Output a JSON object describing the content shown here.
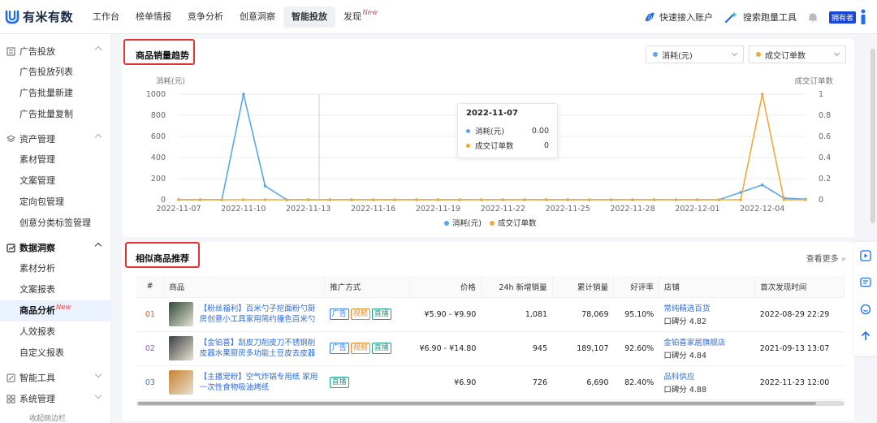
{
  "brand": {
    "name": "有米有数",
    "accent": "#1e6cf0"
  },
  "nav": {
    "items": [
      {
        "label": "工作台"
      },
      {
        "label": "榜单情报"
      },
      {
        "label": "竞争分析"
      },
      {
        "label": "创意洞察"
      },
      {
        "label": "智能投放",
        "active": true
      },
      {
        "label": "发现",
        "badge": "New"
      }
    ],
    "quick_link": "快速接入账户",
    "search_tool": "搜索跑量工具",
    "owner_badge": "拥有者"
  },
  "sidebar": {
    "sections": [
      {
        "label": "广告投放",
        "icon": "ad-icon",
        "items": [
          "广告投放列表",
          "广告批量新建",
          "广告批量复制"
        ]
      },
      {
        "label": "资产管理",
        "icon": "layers-icon",
        "items": [
          "素材管理",
          "文案管理",
          "定向包管理",
          "创意分类标签管理"
        ]
      },
      {
        "label": "数据洞察",
        "icon": "insight-icon",
        "items": [
          "素材分析",
          "文案报表",
          "商品分析",
          "人效报表",
          "自定义报表"
        ],
        "active_item": "商品分析",
        "active_badge": "New"
      },
      {
        "label": "智能工具",
        "icon": "tool-icon"
      },
      {
        "label": "系统管理",
        "icon": "grid-icon"
      }
    ],
    "collapse_label": "收起侧边栏"
  },
  "trend": {
    "title": "商品销量趋势",
    "dropdown_left": "消耗(元)",
    "dropdown_right": "成交订单数",
    "tooltip": {
      "date": "2022-11-07",
      "rows": [
        {
          "label": "消耗(元)",
          "value": "0.00"
        },
        {
          "label": "成交订单数",
          "value": "0"
        }
      ]
    }
  },
  "chart_data": {
    "type": "line",
    "ylabel": "消耗(元)",
    "ylabel_right": "成交订单数",
    "ylim": [
      0,
      1000
    ],
    "ylim_right": [
      0,
      1
    ],
    "yticks": [
      "0",
      "200",
      "400",
      "600",
      "800",
      "1000"
    ],
    "yticks_right": [
      "0",
      "0.2",
      "0.4",
      "0.6",
      "0.8",
      "1"
    ],
    "xticks": [
      "2022-11-07",
      "2022-11-10",
      "2022-11-13",
      "2022-11-16",
      "2022-11-19",
      "2022-11-22",
      "2022-11-25",
      "2022-11-28",
      "2022-12-01",
      "2022-12-04"
    ],
    "x": [
      "2022-11-07",
      "2022-11-08",
      "2022-11-09",
      "2022-11-10",
      "2022-11-11",
      "2022-11-12",
      "2022-11-13",
      "2022-11-14",
      "2022-11-15",
      "2022-11-16",
      "2022-11-17",
      "2022-11-18",
      "2022-11-19",
      "2022-11-20",
      "2022-11-21",
      "2022-11-22",
      "2022-11-23",
      "2022-11-24",
      "2022-11-25",
      "2022-11-26",
      "2022-11-27",
      "2022-11-28",
      "2022-11-29",
      "2022-11-30",
      "2022-12-01",
      "2022-12-02",
      "2022-12-03",
      "2022-12-04",
      "2022-12-05",
      "2022-12-06"
    ],
    "series": [
      {
        "name": "消耗(元)",
        "color": "#5aa6e8",
        "axis": "left",
        "values": [
          0,
          0,
          0,
          1000,
          130,
          0,
          0,
          0,
          0,
          0,
          0,
          0,
          0,
          0,
          0,
          0,
          0,
          0,
          0,
          0,
          0,
          0,
          0,
          0,
          0,
          0,
          70,
          140,
          15,
          5
        ]
      },
      {
        "name": "成交订单数",
        "color": "#f0a93a",
        "axis": "right",
        "values": [
          0,
          0,
          0,
          0,
          0,
          0,
          0,
          0,
          0,
          0,
          0,
          0,
          0,
          0,
          0,
          0,
          0,
          0,
          0,
          0,
          0,
          0,
          0,
          0,
          0,
          0,
          0,
          1,
          0,
          0
        ]
      }
    ],
    "grid": true,
    "legend": "bottom-center"
  },
  "similar": {
    "title": "相似商品推荐",
    "more": "查看更多",
    "columns": [
      "#",
      "商品",
      "推广方式",
      "价格",
      "24h 新增销量",
      "累计销量",
      "好评率",
      "店铺",
      "首次发现时间"
    ],
    "rows": [
      {
        "idx": "01",
        "idx_color": "#e0572e",
        "name": "【粉丝福利】百米勺子挖面粉勺厨房创意小工具家用简约撞色百米勺",
        "tags": [
          "广告",
          "视频",
          "直播"
        ],
        "price": "¥5.90 - ¥9.90",
        "new24": "1,081",
        "total": "78,069",
        "rate": "95.10%",
        "shop": "常纯精选百货",
        "score": "口碑分 4.82",
        "first": "2022-08-29 22:29"
      },
      {
        "idx": "02",
        "idx_color": "#9a55d6",
        "name": "【金铂喜】刮皮刀削皮刀不锈钢削皮器水果厨房多功能土豆皮去皮器",
        "tags": [
          "广告",
          "视频",
          "直播"
        ],
        "price": "¥6.90 - ¥14.80",
        "new24": "945",
        "total": "189,107",
        "rate": "92.60%",
        "shop": "金铂喜家居旗舰店",
        "score": "口碑分 4.84",
        "first": "2021-09-13 13:07"
      },
      {
        "idx": "03",
        "idx_color": "#3a7be0",
        "name": "【主播宠粉】空气炸锅专用纸 家用一次性食物吸油烤纸",
        "tags": [
          "直播"
        ],
        "price": "¥6.90",
        "new24": "726",
        "total": "6,690",
        "rate": "82.40%",
        "shop": "品科供应",
        "score": "口碑分 4.88",
        "first": "2022-11-23 12:00"
      }
    ]
  }
}
